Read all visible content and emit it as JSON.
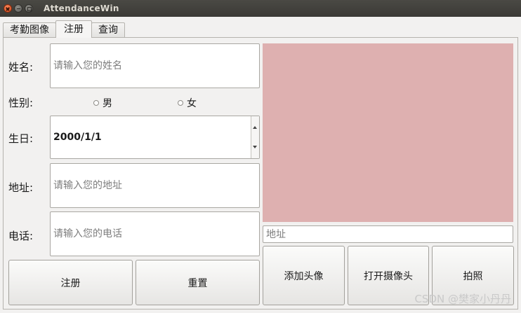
{
  "window": {
    "title": "AttendanceWin"
  },
  "tabs": [
    {
      "label": "考勤图像",
      "active": false
    },
    {
      "label": "注册",
      "active": true
    },
    {
      "label": "查询",
      "active": false
    }
  ],
  "form": {
    "name_label": "姓名:",
    "name_placeholder": "请输入您的姓名",
    "gender_label": "性别:",
    "gender_options": [
      "男",
      "女"
    ],
    "birthday_label": "生日:",
    "birthday_value": "2000/1/1",
    "address_label": "地址:",
    "address_placeholder": "请输入您的地址",
    "phone_label": "电话:",
    "phone_placeholder": "请输入您的电话"
  },
  "buttons": {
    "register": "注册",
    "reset": "重置",
    "add_avatar": "添加头像",
    "open_camera": "打开摄像头",
    "capture": "拍照"
  },
  "photo": {
    "path_placeholder": "地址",
    "background_color": "#deb0b0"
  },
  "watermark": "CSDN @樊家小丹丹"
}
